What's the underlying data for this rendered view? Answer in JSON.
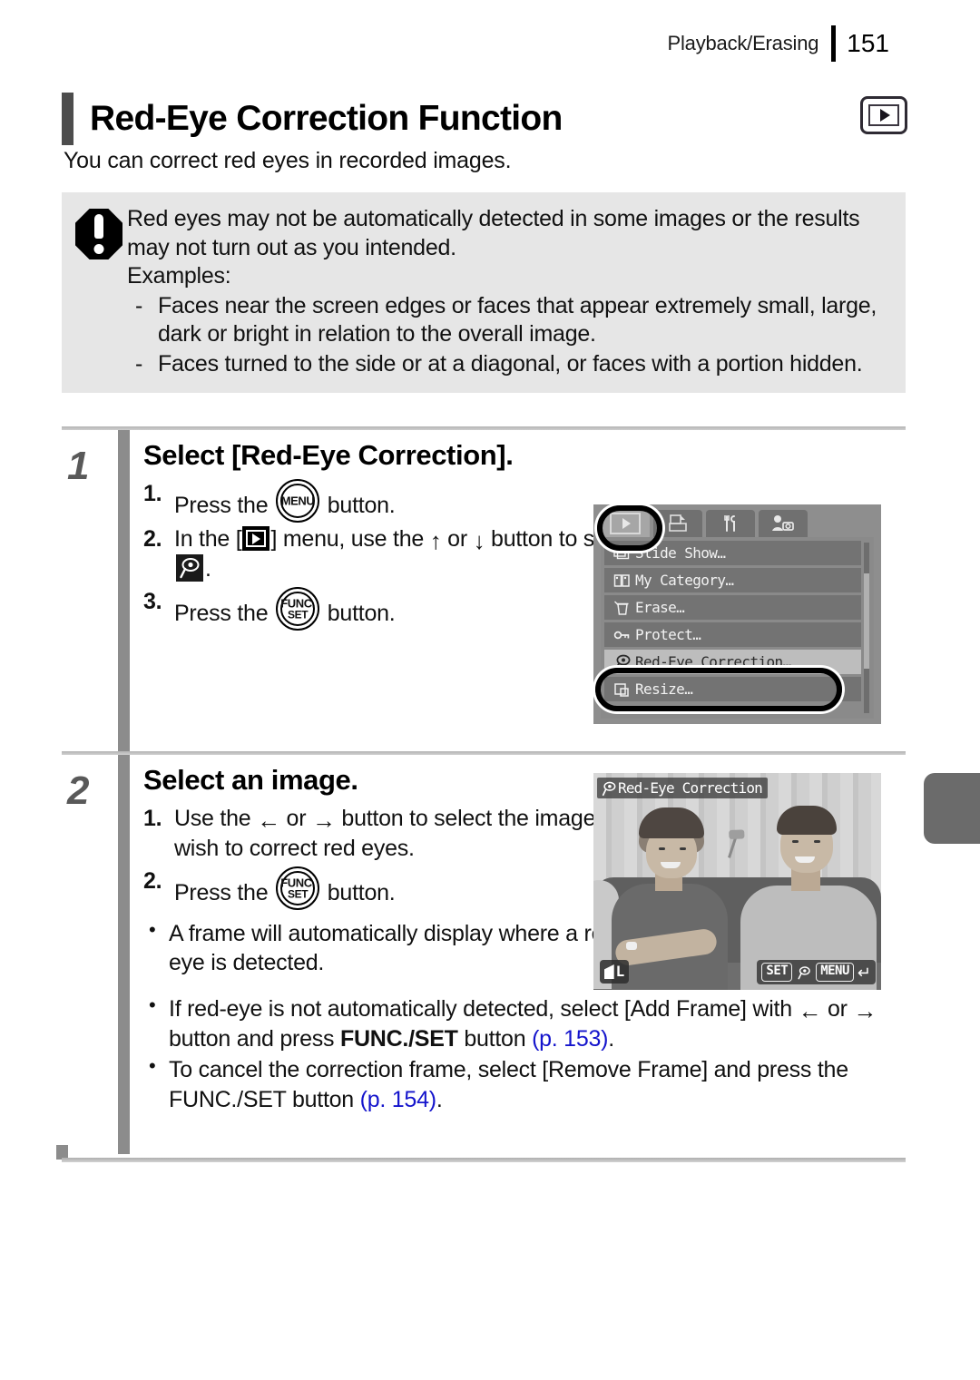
{
  "header": {
    "section": "Playback/Erasing",
    "page_number": "151"
  },
  "title": {
    "text": "Red-Eye Correction Function",
    "mode_icon": "playback-icon"
  },
  "lead": "You can correct red eyes in recorded images.",
  "warning": {
    "icon": "warning-exclamation-icon",
    "paragraph": "Red eyes may not be automatically detected in some images or the results may not turn out as you intended.",
    "examples_label": "Examples:",
    "items": [
      "Faces near the screen edges or faces that appear extremely small, large, dark or bright in relation to the overall image.",
      "Faces turned to the side or at a diagonal, or faces with a portion hidden."
    ]
  },
  "steps": [
    {
      "number": "1",
      "title": "Select [Red-Eye Correction].",
      "substeps": [
        {
          "n": "1.",
          "pre": "Press the ",
          "icon": "menu-button-icon",
          "post": " button."
        },
        {
          "n": "2.",
          "pre": "In the [",
          "icon": "playback-menu-icon",
          "mid": "] menu, use the ",
          "arrow_up": "↑",
          "or": " or ",
          "arrow_down": "↓",
          "post": " button to select ",
          "icon2": "red-eye-correction-icon",
          "end": "."
        },
        {
          "n": "3.",
          "pre": "Press the ",
          "icon": "func-set-button-icon",
          "post": " button."
        }
      ]
    },
    {
      "number": "2",
      "title": "Select an image.",
      "substeps": [
        {
          "n": "1.",
          "pre": "Use the ",
          "arrow_left": "←",
          "or": " or ",
          "arrow_right": "→",
          "post": " button to select the image you wish to correct red eyes."
        },
        {
          "n": "2.",
          "pre": "Press the ",
          "icon": "func-set-button-icon",
          "post": " button."
        }
      ],
      "bullets": [
        {
          "text": "A frame will automatically display where a red eye is detected."
        },
        {
          "pre": "If red-eye is not automatically detected, select [Add Frame] with ",
          "arrow_left": "←",
          "or": " or ",
          "arrow_right": "→",
          "mid": " button and press ",
          "bold": "FUNC./SET",
          "post": " button ",
          "link": "(p. 153)",
          "end": "."
        },
        {
          "pre": "To cancel the correction frame, select [Remove Frame] and press the FUNC./SET button ",
          "link": "(p. 154)",
          "end": "."
        }
      ]
    }
  ],
  "lcd_menu": {
    "tabs": [
      {
        "name": "playback-tab",
        "active": true
      },
      {
        "name": "print-tab",
        "active": false
      },
      {
        "name": "settings-tab",
        "active": false
      },
      {
        "name": "my-camera-tab",
        "active": false
      }
    ],
    "items": [
      {
        "label": "Slide Show…",
        "icon": "slide-show-icon",
        "selected": false
      },
      {
        "label": "My Category…",
        "icon": "my-category-icon",
        "selected": false
      },
      {
        "label": "Erase…",
        "icon": "erase-icon",
        "selected": false
      },
      {
        "label": "Protect…",
        "icon": "protect-icon",
        "selected": false
      },
      {
        "label": "Red-Eye Correction…",
        "icon": "red-eye-correction-icon",
        "selected": true
      },
      {
        "label": "Resize…",
        "icon": "resize-icon",
        "selected": false
      }
    ]
  },
  "lcd_photo": {
    "title": "Red-Eye Correction",
    "title_icon": "red-eye-correction-icon",
    "quality": "L",
    "quality_icon": "fine-quality-icon",
    "keys": {
      "set": "SET",
      "redeye_icon": "red-eye-correction-icon",
      "menu": "MENU",
      "return_icon": "return-arrow-icon"
    }
  },
  "colors": {
    "link_blue": "#1414cc",
    "warning_bg": "#e6e6e6",
    "accent_gray": "#8c8c8c"
  }
}
